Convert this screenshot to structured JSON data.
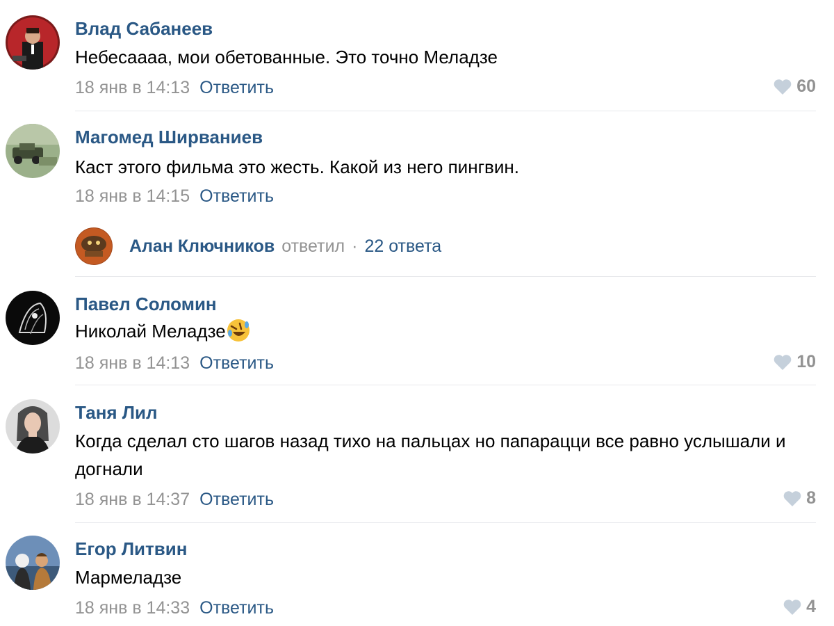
{
  "reply_label": "Ответить",
  "comments": [
    {
      "author": "Влад Сабанеев",
      "text": "Небесаааа, мои обетованные. Это точно Меладзе",
      "date": "18 янв в 14:13",
      "likes": "60"
    },
    {
      "author": "Магомед Ширваниев",
      "text": "Каст этого фильма это жесть. Какой из него пингвин.",
      "date": "18 янв в 14:15",
      "thread": {
        "author": "Алан Ключников",
        "action": "ответил",
        "separator": "·",
        "count": "22 ответа"
      }
    },
    {
      "author": "Павел Соломин",
      "text": "Николай Меладзе",
      "emoji": "rolling-on-floor-laughing-emoji",
      "date": "18 янв в 14:13",
      "likes": "10"
    },
    {
      "author": "Таня Лил",
      "text": "Когда сделал сто шагов назад тихо на пальцах но папарацци все равно услышали и догнали",
      "date": "18 янв в 14:37",
      "likes": "8"
    },
    {
      "author": "Егор Литвин",
      "text": "Мармеладзе",
      "date": "18 янв в 14:33",
      "likes": "4"
    }
  ],
  "colors": {
    "link": "#2a5885",
    "muted": "#939393",
    "divider": "#e7e8ec",
    "heart": "#c5d0db"
  },
  "icons": {
    "like": "heart-icon",
    "avatar": "user-avatar"
  }
}
